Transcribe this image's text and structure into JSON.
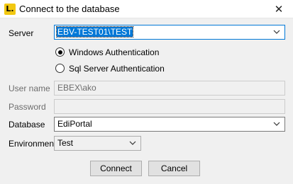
{
  "window": {
    "title": "Connect to the database",
    "app_icon_letter": "L.",
    "close_glyph": "✕"
  },
  "form": {
    "server_label": "Server",
    "server_value": "EBV-TEST01\\TEST",
    "auth_windows_label": "Windows Authentication",
    "auth_sql_label": "Sql Server Authentication",
    "auth_selected": "Windows Authentication",
    "username_label": "User name",
    "username_value": "EBEX\\ako",
    "password_label": "Password",
    "password_value": "",
    "database_label": "Database",
    "database_value": "EdiPortal",
    "environment_label": "Environment",
    "environment_value": "Test"
  },
  "buttons": {
    "connect_label": "Connect",
    "cancel_label": "Cancel"
  },
  "colors": {
    "selection": "#0078d7",
    "app_icon": "#f2c811"
  }
}
